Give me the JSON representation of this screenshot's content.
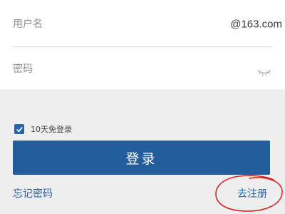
{
  "login_form": {
    "username": {
      "placeholder": "用户名",
      "value": "",
      "domain_suffix": "@163.com"
    },
    "password": {
      "placeholder": "密码",
      "value": "",
      "toggle_icon": "eye-closed-icon"
    },
    "remember_me": {
      "label": "10天免登录",
      "checked": true
    },
    "login_button_label": "登录",
    "forgot_password_label": "忘记密码",
    "register_label": "去注册"
  },
  "colors": {
    "primary": "#245d9e",
    "link": "#2a5fa0",
    "annotation": "#e02020",
    "background": "#eeeeee"
  }
}
